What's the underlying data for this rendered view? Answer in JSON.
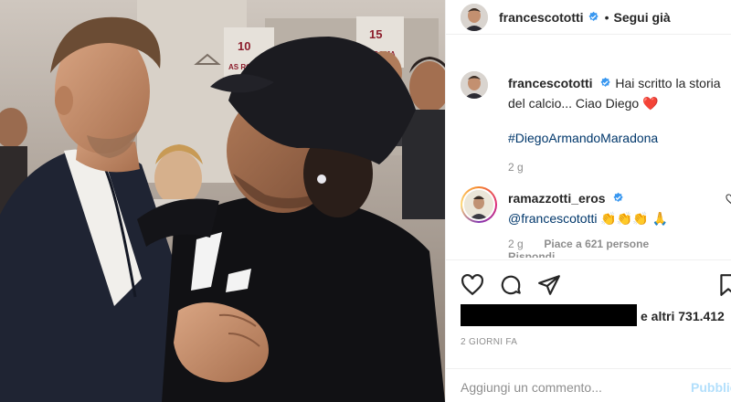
{
  "post": {
    "author": "francescototti",
    "follow_status": "Segui già",
    "caption_line1": "Hai scritto la storia",
    "caption_line2": "del calcio... Ciao Diego",
    "caption_emoji": "❤️",
    "hashtag": "#DiegoArmandoMaradona",
    "caption_age": "2 g",
    "likes_suffix": "e altri 731.412",
    "posted": "2 GIORNI FA"
  },
  "comment": {
    "author": "ramazzotti_eros",
    "mention": "@francescototti",
    "emojis": "👏👏👏 🙏",
    "age": "2 g",
    "likes": "Piace a 621 persone",
    "reply": "Rispondi"
  },
  "add_comment": {
    "placeholder": "Aggiungi un commento...",
    "publish_label": "Pubblica"
  },
  "photo": {
    "poster_left": "10",
    "poster_right": "15",
    "poster_brand": "AS ROMA"
  },
  "icons": {
    "like": "heart-outline-icon",
    "comment": "comment-bubble-icon",
    "share": "paper-plane-icon",
    "save": "bookmark-icon",
    "verified": "verified-badge-icon"
  },
  "colors": {
    "verified": "#3897f0",
    "link": "#00376b",
    "muted": "#8e8e8e",
    "heart": "#ed4956",
    "publish": "#b2dffc"
  }
}
